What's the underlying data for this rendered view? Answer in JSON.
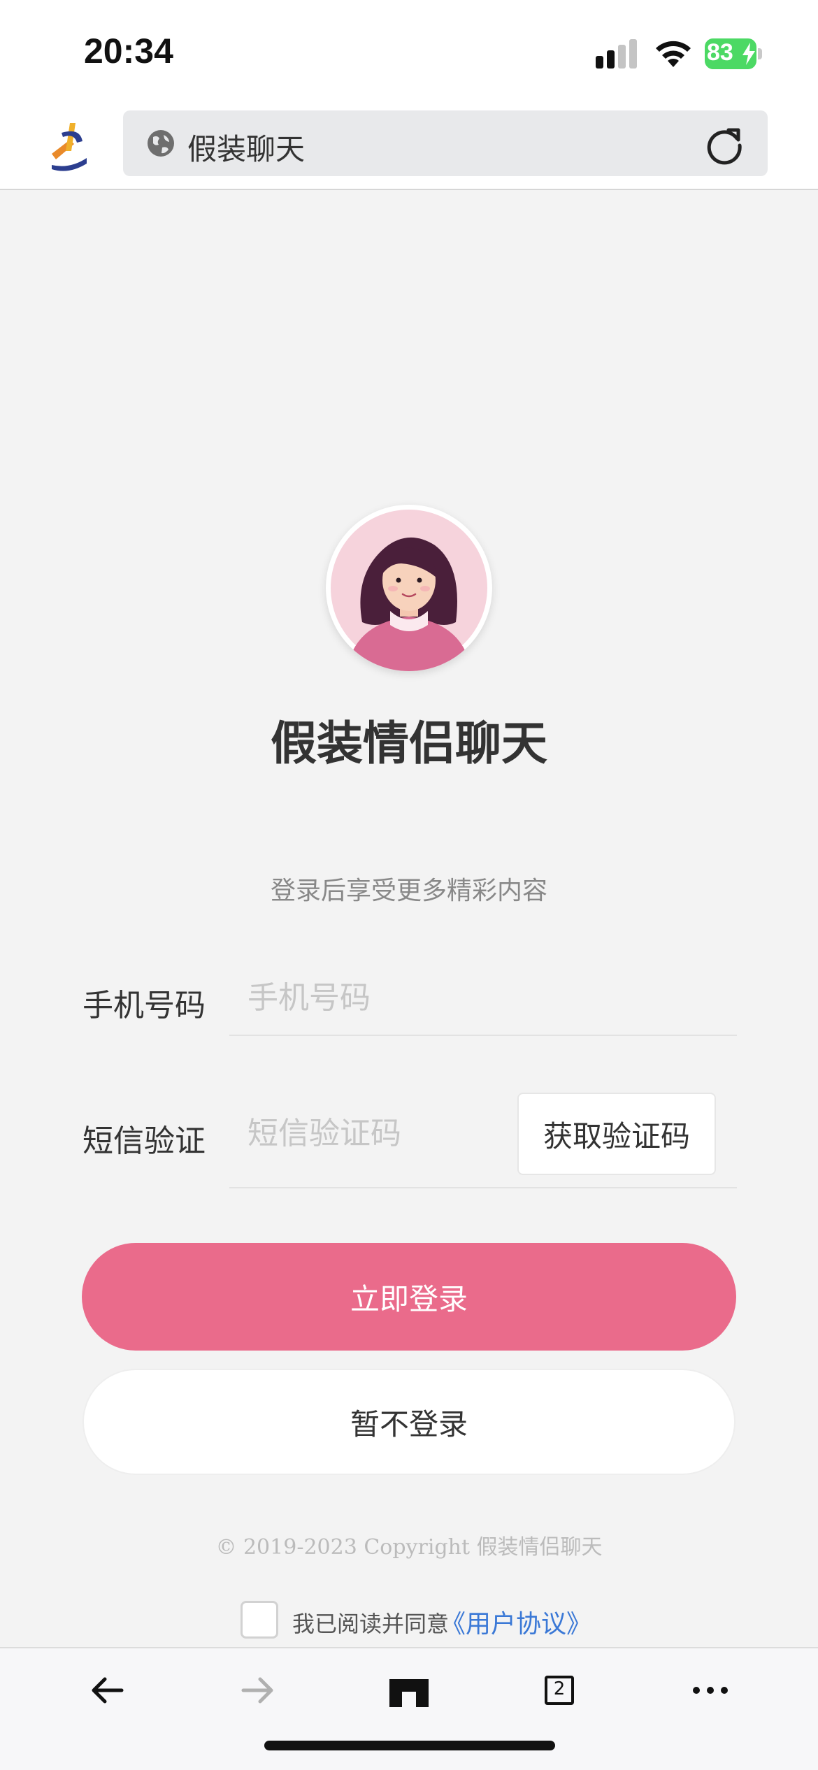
{
  "status_bar": {
    "time": "20:34",
    "battery": "83"
  },
  "browser": {
    "address_text": "假装聊天"
  },
  "app": {
    "title": "假装情侣聊天",
    "subtitle": "登录后享受更多精彩内容"
  },
  "form": {
    "phone": {
      "label": "手机号码",
      "placeholder": "手机号码"
    },
    "sms": {
      "label": "短信验证",
      "placeholder": "短信验证码",
      "button": "获取验证码"
    }
  },
  "buttons": {
    "login": "立即登录",
    "skip": "暂不登录"
  },
  "footer": {
    "copyright": "© 2019-2023 Copyright 假装情侣聊天",
    "agree_text": "我已阅读并同意",
    "agree_link": "《用户协议》"
  },
  "toolbar": {
    "tab_count": "2"
  },
  "colors": {
    "primary": "#ea6b8b",
    "link": "#3a78d6",
    "battery": "#4cd964"
  }
}
